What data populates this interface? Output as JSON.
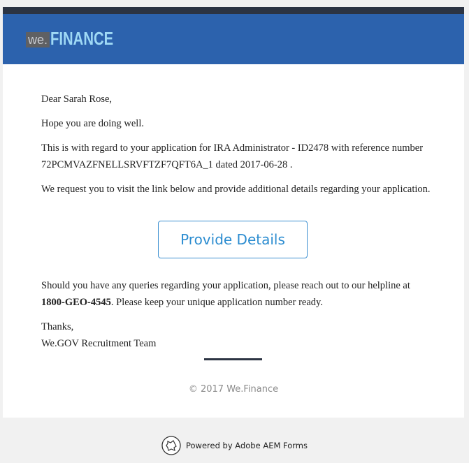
{
  "header": {
    "logo_we": "we.",
    "logo_finance": "FINANCE"
  },
  "email": {
    "greeting": "Dear Sarah Rose,",
    "hope": "Hope you are doing well.",
    "regard_line": "This is with regard to your  application for  IRA Administrator - ID2478 with reference number 72PCMVAZFNELLSRVFTZF7QFT6A_1 dated 2017-06-28 .",
    "request": "We request you to visit the link below and provide additional details regarding your application.",
    "button_label": "Provide Details",
    "queries_prefix": "Should you have any queries regarding your application, please reach out to our helpline at",
    "helpline": "1800-GEO-4545",
    "queries_suffix": ". Please keep your unique application number ready.",
    "thanks": "Thanks,",
    "team": "We.GOV Recruitment Team"
  },
  "copyright": "© 2017 We.Finance",
  "footer": {
    "powered_by": "Powered by Adobe AEM Forms",
    "icon": "adobe-aem-icon"
  },
  "colors": {
    "header_bg": "#2c62ad",
    "top_bar": "#2c3443",
    "button_border": "#3b8fd0",
    "button_text": "#2b8cd0"
  }
}
